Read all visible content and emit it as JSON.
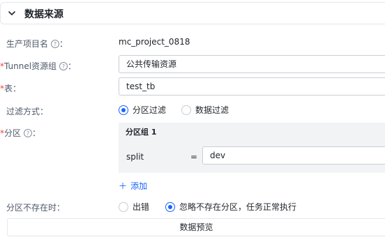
{
  "section": {
    "title": "数据来源",
    "icon": "chevron-down-icon"
  },
  "fields": {
    "project": {
      "label": "生产项目名",
      "help": "?",
      "suffix": "：",
      "value": "mc_project_0818"
    },
    "tunnel": {
      "required": "*",
      "label": "Tunnel资源组",
      "help": "?",
      "suffix": "：",
      "value": "公共传输资源"
    },
    "table": {
      "required": "*",
      "label": "表",
      "suffix": "：",
      "value": "test_tb"
    },
    "filter": {
      "label": "过滤方式",
      "suffix": "：",
      "options": [
        "分区过滤",
        "数据过滤"
      ],
      "selected": "分区过滤"
    },
    "partition": {
      "required": "*",
      "label": "分区",
      "help": "?",
      "suffix": "：",
      "group_title": "分区组 1",
      "key": "split",
      "operator": "=",
      "value": "dev",
      "add_label": "添加",
      "add_icon": "plus-icon"
    },
    "missing": {
      "label": "分区不存在时",
      "suffix": "：",
      "options": [
        "出错",
        "忽略不存在分区，任务正常执行"
      ],
      "selected": "忽略不存在分区，任务正常执行"
    }
  },
  "preview_button": {
    "label": "数据预览"
  },
  "colors": {
    "accent": "#1664ff",
    "required": "#f53f3f",
    "panel_bg": "#f2f3f5"
  }
}
